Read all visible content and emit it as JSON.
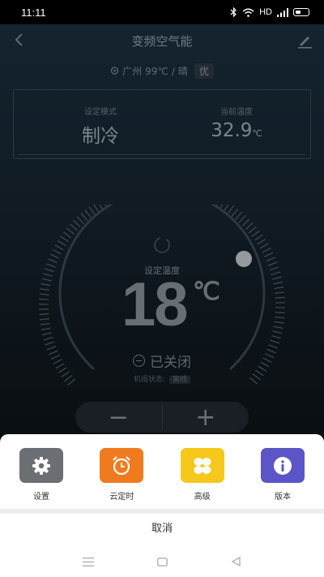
{
  "status_bar": {
    "time": "11:11",
    "network": "HD"
  },
  "header": {
    "title": "变频空气能"
  },
  "weather": {
    "city": "广州",
    "temp": "99℃",
    "separator": "/",
    "condition": "晴",
    "air_quality": "优"
  },
  "info_card": {
    "mode_label": "设定模式",
    "mode_value": "制冷",
    "current_label": "当前温度",
    "current_value": "32.9",
    "current_unit": "℃"
  },
  "dial": {
    "set_label": "设定温度",
    "set_value": "18",
    "unit": "℃",
    "power_status": "已关闭",
    "unit_state_label": "机组状态:",
    "unit_state_value": "离线"
  },
  "stepper": {
    "minus": "−",
    "plus": "+"
  },
  "action_sheet": {
    "items": [
      {
        "label": "设置",
        "icon": "gear-icon",
        "color": "#6b6e73"
      },
      {
        "label": "云定时",
        "icon": "alarm-clock-icon",
        "color": "#f07b1e"
      },
      {
        "label": "高级",
        "icon": "grid-flower-icon",
        "color": "#f6c81b"
      },
      {
        "label": "版本",
        "icon": "info-icon",
        "color": "#5b55c8"
      }
    ],
    "cancel": "取消"
  },
  "colors": {
    "accent_orange": "#f07b1e",
    "accent_yellow": "#f6c81b",
    "accent_purple": "#5b55c8",
    "app_bg": "#16242f"
  }
}
